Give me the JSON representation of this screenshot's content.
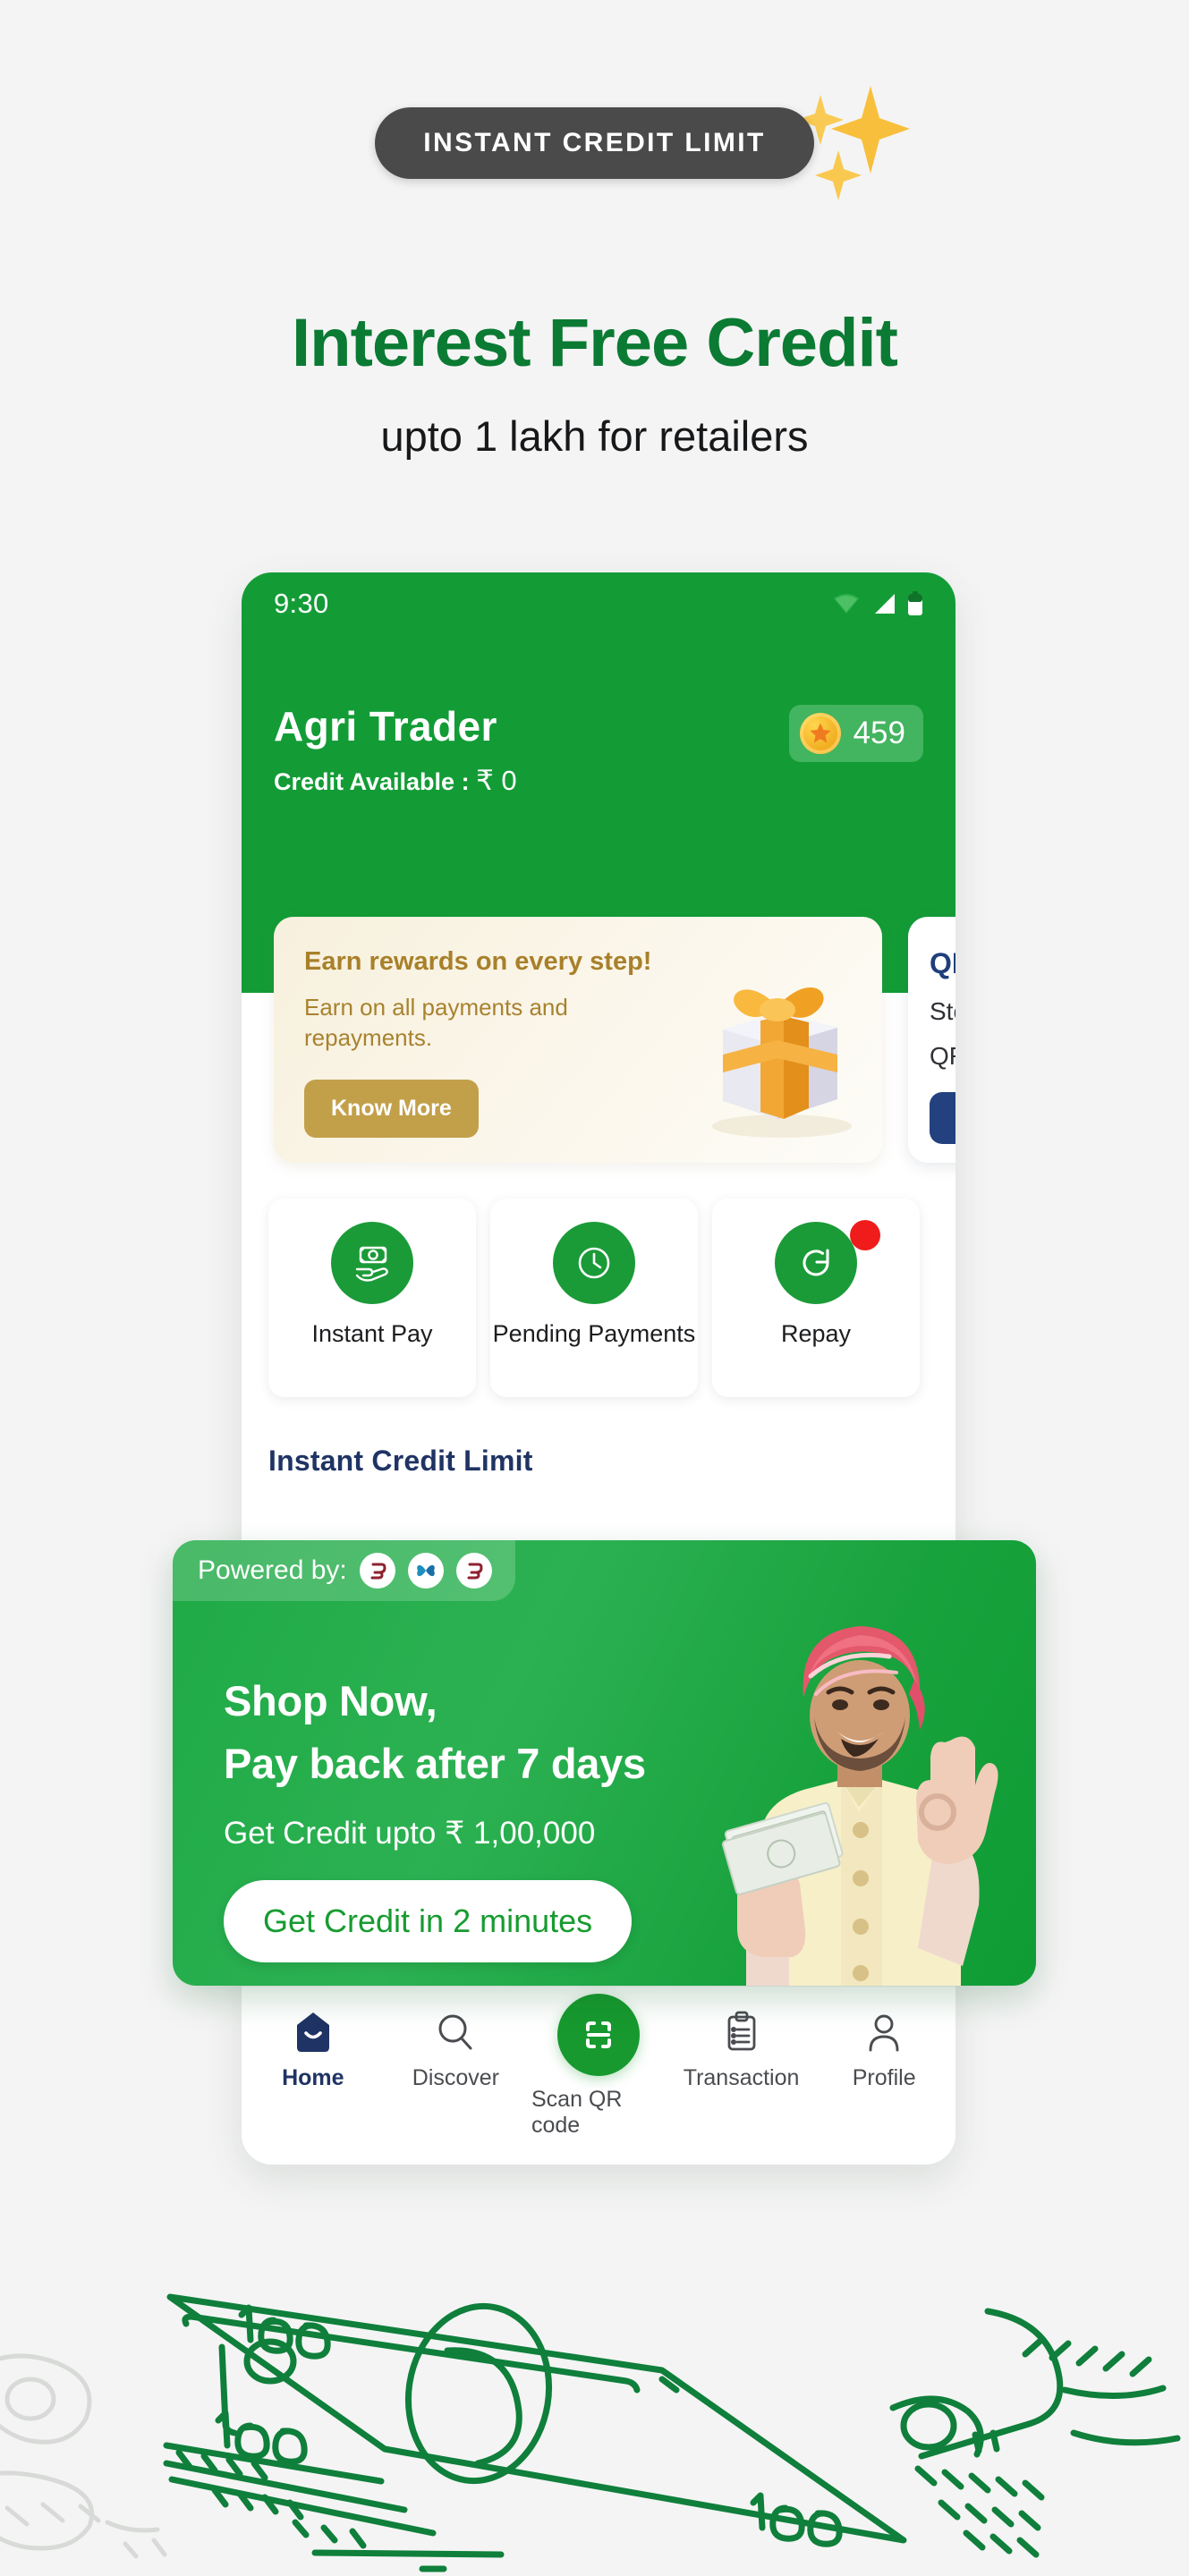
{
  "badge": {
    "label": "INSTANT CREDIT LIMIT",
    "bg_color": "#4a4a4a",
    "sparkle_color": "#f7b733"
  },
  "hero": {
    "headline": "Interest Free Credit",
    "headline_color": "#0b7a33",
    "subheadline": "upto 1 lakh for retailers"
  },
  "phone": {
    "status_bar": {
      "time": "9:30",
      "icons": [
        "wifi-icon",
        "signal-icon",
        "battery-icon"
      ]
    },
    "header": {
      "app_title": "Agri Trader",
      "credit_label": "Credit Available :",
      "credit_amount": "₹ 0",
      "coin_badge": {
        "value": "459",
        "icon": "coin-star-icon"
      },
      "bg_color": "#139C36"
    },
    "rewards_card": {
      "title": "Earn rewards on every step!",
      "subtitle": "Earn on all payments and repayments.",
      "button_label": "Know More",
      "button_color": "#c2a04a",
      "title_color": "#a8802a",
      "icon": "gift-box-icon"
    },
    "qr_card": {
      "title": "QR",
      "line1": "Sto",
      "line2": "QR",
      "button_color": "#22417e"
    },
    "tiles": [
      {
        "label": "Instant Pay",
        "icon": "money-in-hand-icon",
        "badge": false
      },
      {
        "label": "Pending Payments",
        "icon": "clock-icon",
        "badge": false
      },
      {
        "label": "Repay",
        "icon": "refresh-icon",
        "badge": true
      }
    ],
    "section_title": "Instant Credit Limit",
    "bottom_nav": [
      {
        "label": "Home",
        "icon": "home-tag-icon",
        "active": true
      },
      {
        "label": "Discover",
        "icon": "search-icon",
        "active": false
      },
      {
        "label": "Scan QR code",
        "icon": "scan-qr-icon",
        "active": false
      },
      {
        "label": "Transaction",
        "icon": "clipboard-list-icon",
        "active": false
      },
      {
        "label": "Profile",
        "icon": "person-icon",
        "active": false
      }
    ]
  },
  "promo": {
    "powered_by_label": "Powered by:",
    "partner_logos": [
      "partner-swirl-icon",
      "partner-butterfly-icon",
      "partner-swirl-icon"
    ],
    "heading_line1": "Shop Now,",
    "heading_line2": "Pay back after 7 days",
    "subtext": "Get Credit upto ₹ 1,00,000",
    "cta_label": "Get Credit in 2 minutes",
    "cta_text_color": "#179b30",
    "bg_color": "#1faa46",
    "photo": "farmer-ok-gesture-photo"
  },
  "footer_illustration": {
    "icon": "hand-holding-cash-line-art",
    "note_value": "100",
    "color": "#0f7f3b"
  }
}
